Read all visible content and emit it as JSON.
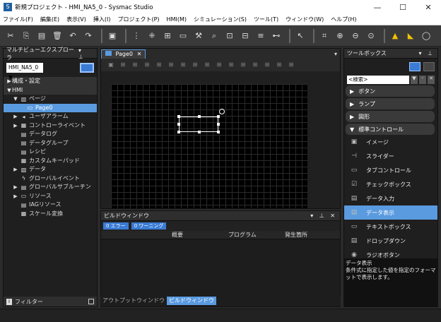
{
  "window": {
    "title": "新規プロジェクト - HMI_NA5_0 - Sysmac Studio",
    "minimize": "—",
    "maximize": "☐",
    "close": "✕",
    "logo": "S"
  },
  "menu": [
    "ファイル(F)",
    "編集(E)",
    "表示(V)",
    "挿入(I)",
    "プロジェクト(P)",
    "HMI(M)",
    "シミュレーション(S)",
    "ツール(T)",
    "ウィンドウ(W)",
    "ヘルプ(H)"
  ],
  "toolbar_icons": [
    "cut-icon",
    "copy-icon",
    "paste-icon",
    "delete-icon",
    "undo-icon",
    "redo-icon",
    "sep",
    "build-icon",
    "sep",
    "grid-icon",
    "align-icon",
    "group-icon",
    "view-icon",
    "tools-icon",
    "find-icon",
    "program-icon",
    "window-icon",
    "list-icon",
    "online-icon",
    "sep",
    "cursor-icon",
    "sep",
    "fit-icon",
    "zoom-in-icon",
    "zoom-out-icon",
    "zoom-region-icon",
    "sep",
    "warning-icon",
    "stop-icon",
    "reset-icon"
  ],
  "left_panel": {
    "title": "マルチビューエクスプローラ",
    "pin": "▾ ⊥",
    "device": "HMI_NA5_0",
    "device_arrow": "▼",
    "tree": [
      {
        "label": "構成・設定",
        "level": 0,
        "toggle": "▶",
        "section": true
      },
      {
        "label": "HMI",
        "level": 0,
        "toggle": "▼",
        "section": true
      },
      {
        "label": "ページ",
        "level": 1,
        "toggle": "▼",
        "icon": "▥"
      },
      {
        "label": "Page0",
        "level": 2,
        "toggle": "",
        "icon": "▭",
        "selected": true
      },
      {
        "label": "ユーザアラーム",
        "level": 1,
        "toggle": "▶",
        "icon": "◂"
      },
      {
        "label": "コントローライベント",
        "level": 1,
        "toggle": "▶",
        "icon": "▦"
      },
      {
        "label": "データログ",
        "level": 1,
        "toggle": "",
        "icon": "▤"
      },
      {
        "label": "データグループ",
        "level": 1,
        "toggle": "",
        "icon": "▤"
      },
      {
        "label": "レシピ",
        "level": 1,
        "toggle": "",
        "icon": "▤"
      },
      {
        "label": "カスタムキーパッド",
        "level": 1,
        "toggle": "",
        "icon": "▦"
      },
      {
        "label": "データ",
        "level": 1,
        "toggle": "▶",
        "icon": "▧"
      },
      {
        "label": "グローバルイベント",
        "level": 1,
        "toggle": "",
        "icon": "ϟ"
      },
      {
        "label": "グローバルサブルーチン",
        "level": 1,
        "toggle": "▶",
        "icon": "▤"
      },
      {
        "label": "リソース",
        "level": 1,
        "toggle": "▶",
        "icon": "▭"
      },
      {
        "label": "IAGリソース",
        "level": 1,
        "toggle": "",
        "icon": "▤"
      },
      {
        "label": "スケール変換",
        "level": 1,
        "toggle": "",
        "icon": "▦"
      }
    ],
    "filter_label": "フィルター",
    "filter_icon": "i"
  },
  "editor": {
    "tab_label": "Page0",
    "tab_close": "✕",
    "tab_dropdown": "▾"
  },
  "build_window": {
    "title": "ビルドウィンドウ",
    "pin": "▾ ⊥ ✕",
    "errors_badge": "0 エラー",
    "warnings_badge": "0 ワーニング",
    "columns": [
      "概要",
      "プログラム",
      "発生箇所"
    ]
  },
  "bottom_tabs": [
    "アウトプットウィンドウ",
    "ビルドウィンドウ"
  ],
  "toolbox": {
    "title": "ツールボックス",
    "pin": "▾ ⊥",
    "search_placeholder": "<検索>",
    "categories": [
      {
        "label": "ボタン",
        "arrow": "▶"
      },
      {
        "label": "ランプ",
        "arrow": "▶"
      },
      {
        "label": "図形",
        "arrow": "▶"
      },
      {
        "label": "標準コントロール",
        "arrow": "▼"
      }
    ],
    "items": [
      {
        "label": "イメージ",
        "icon": "▣"
      },
      {
        "label": "スライダー",
        "icon": "⊣"
      },
      {
        "label": "タブコントロール",
        "icon": "▭"
      },
      {
        "label": "チェックボックス",
        "icon": "☑"
      },
      {
        "label": "データ入力",
        "icon": "▤"
      },
      {
        "label": "データ表示",
        "icon": "▤",
        "selected": true
      },
      {
        "label": "テキストボックス",
        "icon": "▭"
      },
      {
        "label": "ドロップダウン",
        "icon": "▤"
      },
      {
        "label": "ラジオボタン",
        "icon": "◉"
      }
    ],
    "description_title": "データ表示",
    "description": "条件式に指定した値を指定のフォーマットで表示します。"
  }
}
